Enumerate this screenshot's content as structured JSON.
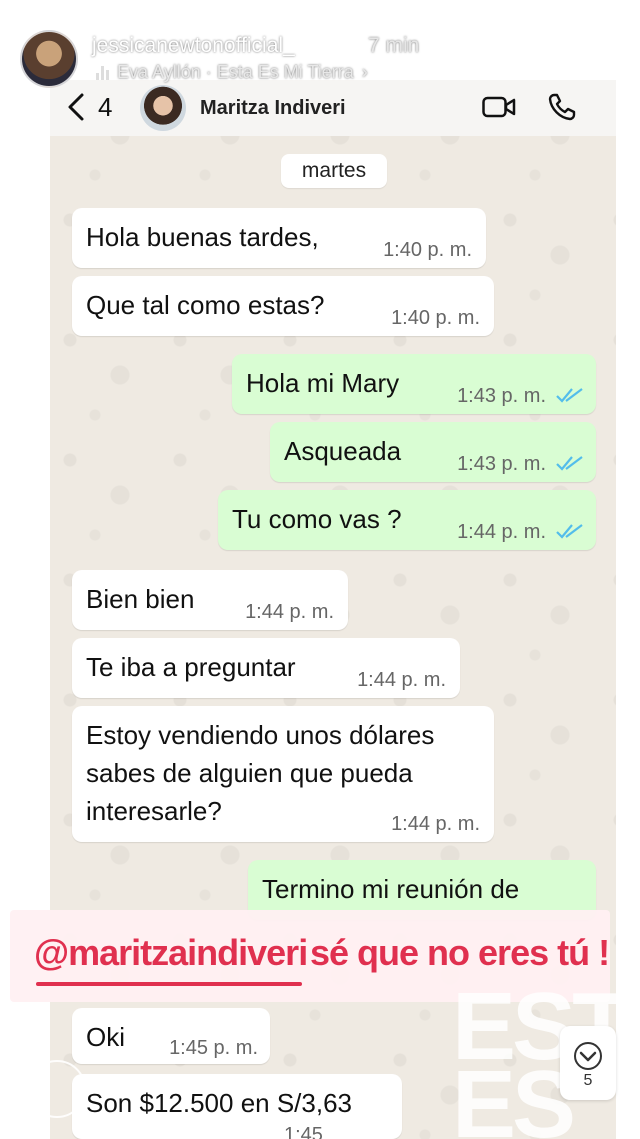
{
  "story": {
    "username": "jessicanewtonofficial_",
    "time_ago": "7 min",
    "music": "Eva Ayllón · Esta Es Mi Tierra",
    "music_chevron": "›",
    "progress_segments": 5,
    "progress_done": 2
  },
  "chat_header": {
    "back_count": "4",
    "contact_name": "Maritza Indiveri"
  },
  "date_separator": "martes",
  "messages": [
    {
      "dir": "in",
      "text": "Hola buenas tardes,",
      "time": "1:40 p. m."
    },
    {
      "dir": "in",
      "text": "Que tal como estas?",
      "time": "1:40 p. m."
    },
    {
      "dir": "out",
      "text": "Hola mi Mary",
      "time": "1:43 p. m.",
      "read": true
    },
    {
      "dir": "out",
      "text": "Asqueada",
      "time": "1:43 p. m.",
      "read": true
    },
    {
      "dir": "out",
      "text": "Tu como vas ?",
      "time": "1:44 p. m.",
      "read": true
    },
    {
      "dir": "in",
      "text": "Bien bien",
      "time": "1:44 p. m."
    },
    {
      "dir": "in",
      "text": "Te iba a preguntar",
      "time": "1:44 p. m."
    },
    {
      "dir": "in",
      "text": "Estoy vendiendo unos dólares sabes de alguien  que pueda interesarle?",
      "time": "1:44 p. m."
    },
    {
      "dir": "out",
      "text": "Termino mi reunión de",
      "time": ""
    },
    {
      "dir": "in",
      "text": "Oki",
      "time": "1:45 p. m."
    },
    {
      "dir": "in",
      "text": "Son $12.500 en S/3,63",
      "time": "1:45"
    }
  ],
  "sticker": {
    "mention": "@maritzaindiveri",
    "text": "sé que no eres tú !"
  },
  "overlay_text": [
    "ESTA",
    "ES"
  ],
  "scroll_button": {
    "count": "5"
  },
  "colors": {
    "incoming": "#ffffff",
    "outgoing": "#d9fdd3",
    "read_ticks": "#53bdeb",
    "mention": "#e0304f"
  }
}
